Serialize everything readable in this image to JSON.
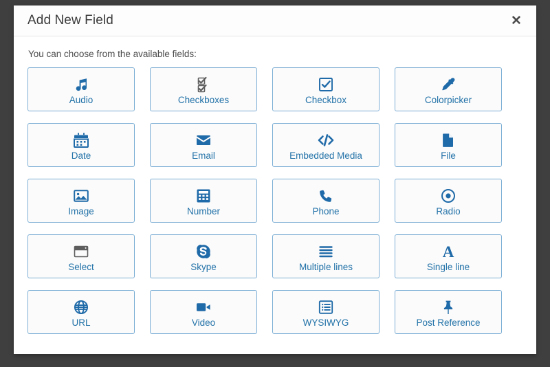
{
  "modal": {
    "title": "Add New Field",
    "close_label": "✕",
    "intro": "You can choose from the available fields:"
  },
  "colors": {
    "accent_blue": "#1f6aa8",
    "label_blue": "#2272a8",
    "tile_border": "#7aadd4",
    "tile_bg": "#fbfbfb",
    "backdrop": "#3f3f3f",
    "grey_icon": "#5d5d5d"
  },
  "fields": [
    {
      "label": "Audio",
      "icon": "music-note-icon",
      "icon_color": "blue"
    },
    {
      "label": "Checkboxes",
      "icon": "checkboxes-icon",
      "icon_color": "grey"
    },
    {
      "label": "Checkbox",
      "icon": "checkbox-icon",
      "icon_color": "blue"
    },
    {
      "label": "Colorpicker",
      "icon": "eyedropper-icon",
      "icon_color": "blue"
    },
    {
      "label": "Date",
      "icon": "calendar-icon",
      "icon_color": "blue"
    },
    {
      "label": "Email",
      "icon": "envelope-icon",
      "icon_color": "blue"
    },
    {
      "label": "Embedded Media",
      "icon": "code-brackets-icon",
      "icon_color": "blue"
    },
    {
      "label": "File",
      "icon": "file-icon",
      "icon_color": "blue"
    },
    {
      "label": "Image",
      "icon": "image-icon",
      "icon_color": "blue"
    },
    {
      "label": "Number",
      "icon": "calculator-icon",
      "icon_color": "blue"
    },
    {
      "label": "Phone",
      "icon": "phone-icon",
      "icon_color": "blue"
    },
    {
      "label": "Radio",
      "icon": "radio-button-icon",
      "icon_color": "blue"
    },
    {
      "label": "Select",
      "icon": "select-window-icon",
      "icon_color": "grey"
    },
    {
      "label": "Skype",
      "icon": "skype-icon",
      "icon_color": "blue"
    },
    {
      "label": "Multiple lines",
      "icon": "multiple-lines-icon",
      "icon_color": "blue"
    },
    {
      "label": "Single line",
      "icon": "letter-a-icon",
      "icon_color": "blue"
    },
    {
      "label": "URL",
      "icon": "globe-icon",
      "icon_color": "blue"
    },
    {
      "label": "Video",
      "icon": "video-camera-icon",
      "icon_color": "blue"
    },
    {
      "label": "WYSIWYG",
      "icon": "list-editor-icon",
      "icon_color": "blue"
    },
    {
      "label": "Post Reference",
      "icon": "pushpin-icon",
      "icon_color": "blue"
    }
  ]
}
